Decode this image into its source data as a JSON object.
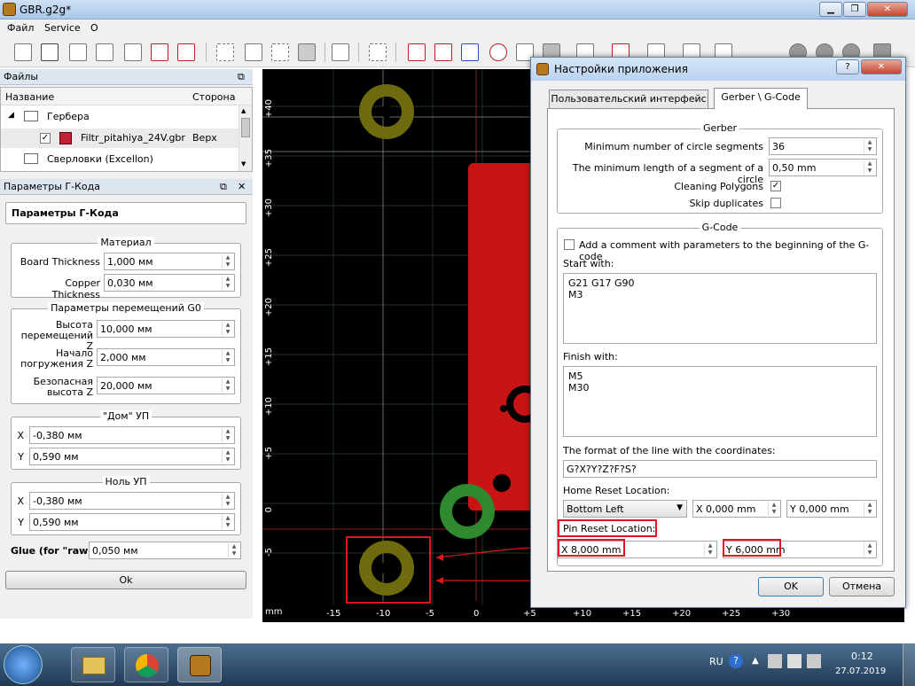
{
  "window": {
    "title": "GBR.g2g*"
  },
  "menu": {
    "items": [
      "Файл",
      "Service",
      "О"
    ]
  },
  "files_panel": {
    "title": "Файлы",
    "col_name": "Название",
    "col_side": "Сторона",
    "groups": [
      {
        "label": "Гербера"
      },
      {
        "label": "Сверловки (Excellon)"
      }
    ],
    "file": {
      "name": "Filtr_pitahiya_24V.gbr",
      "side": "Верх",
      "checked": true,
      "color": "#c0203a"
    }
  },
  "gcode_panel": {
    "title": "Параметры Г-Кода",
    "heading": "Параметры Г-Кода",
    "material": {
      "title": "Материал",
      "board_label": "Board Thickness",
      "board_value": "1,000 мм",
      "copper_label": "Copper Thickness",
      "copper_value": "0,030 мм"
    },
    "moves": {
      "title": "Параметры перемещений G0",
      "height_label1": "Высота",
      "height_label2": "перемещений Z",
      "height_value": "10,000 мм",
      "start_label1": "Начало",
      "start_label2": "погружения Z",
      "start_value": "2,000 мм",
      "safe_label1": "Безопасная",
      "safe_label2": "высота Z",
      "safe_value": "20,000 мм"
    },
    "home": {
      "title": "\"Дом\" УП",
      "x_label": "X",
      "x_value": "-0,380 мм",
      "y_label": "Y",
      "y_value": "0,590 мм"
    },
    "zero": {
      "title": "Ноль УП",
      "x_label": "X",
      "x_value": "-0,380 мм",
      "y_label": "Y",
      "y_value": "0,590 мм"
    },
    "glue_label": "Glue (for \"raw\")",
    "glue_value": "0,050 мм",
    "ok_label": "Ok"
  },
  "canvas": {
    "unit": "mm",
    "x_ticks": [
      "-15",
      "-10",
      "-5",
      "0",
      "+5",
      "+10",
      "+15",
      "+20",
      "+25",
      "+30"
    ],
    "y_ticks": [
      "+40",
      "+35",
      "+30",
      "+25",
      "+20",
      "+15",
      "+10",
      "+5",
      "0",
      "-5"
    ]
  },
  "dialog": {
    "title": "Настройки приложения",
    "tabs": [
      "Пользовательский интерфейс",
      "Gerber \\ G-Code"
    ],
    "gerber": {
      "title": "Gerber",
      "segments_label": "Minimum number of circle segments",
      "segments_value": "36",
      "minlen_label": "The minimum length of a segment of a circle",
      "minlen_value": "0,50 mm",
      "cleaning_label": "Cleaning Polygons",
      "cleaning_checked": true,
      "skip_label": "Skip duplicates",
      "skip_checked": false
    },
    "gcode": {
      "title": "G-Code",
      "comment_label": "Add a comment with parameters to the beginning of the G-code",
      "start_label": "Start with:",
      "start_line1": "G21 G17 G90",
      "start_line2": "M3",
      "finish_label": "Finish with:",
      "finish_line1": "M5",
      "finish_line2": "M30",
      "format_label": "The format of the line with the coordinates:",
      "format_value": "G?X?Y?Z?F?S?",
      "home_label": "Home Reset Location:",
      "home_select": "Bottom Left",
      "home_x": "X 0,000 mm",
      "home_y": "Y 0,000 mm",
      "pin_label": "Pin Reset Location:",
      "pin_x": "X 8,000 mm",
      "pin_y": "Y 6,000 mm"
    },
    "ok_label": "OK",
    "cancel_label": "Отмена"
  },
  "taskbar": {
    "lang": "RU",
    "time": "0:12",
    "date": "27.07.2019"
  },
  "colors": {
    "pcb_red": "#c81414",
    "pad_yellow": "#6e6a0e",
    "pad_green": "#2f8a2f",
    "highlight_red": "#e0151f"
  }
}
